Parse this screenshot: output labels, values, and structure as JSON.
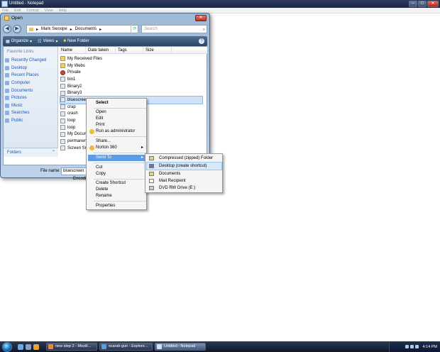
{
  "notepad": {
    "title": "Untitled - Notepad",
    "menu": [
      "File",
      "Edit",
      "Format",
      "View",
      "Help"
    ]
  },
  "dialog": {
    "title": "Open",
    "breadcrumb": [
      "Mark Swoope",
      "Documents"
    ],
    "search_placeholder": "Search",
    "toolbar": {
      "organize": "Organize",
      "views": "Views",
      "new_folder": "New Folder"
    },
    "favorite_links_header": "Favorite Links",
    "favorite_links": [
      "Recently Changed",
      "Desktop",
      "Recent Places",
      "Computer",
      "Documents",
      "Pictures",
      "Music",
      "Searches",
      "Public"
    ],
    "folders_label": "Folders",
    "columns": [
      "Name",
      "Date taken",
      "Tags",
      "Size"
    ],
    "files": [
      {
        "name": "My Received Files",
        "kind": "folder"
      },
      {
        "name": "My Webs",
        "kind": "folder"
      },
      {
        "name": "Private",
        "kind": "app"
      },
      {
        "name": "bin1",
        "kind": "file"
      },
      {
        "name": "Binary2",
        "kind": "file"
      },
      {
        "name": "Binary3",
        "kind": "file"
      },
      {
        "name": "bluescreen",
        "kind": "file"
      },
      {
        "name": "crap",
        "kind": "file"
      },
      {
        "name": "crash",
        "kind": "file"
      },
      {
        "name": "loop",
        "kind": "file"
      },
      {
        "name": "loop",
        "kind": "file"
      },
      {
        "name": "My Docum",
        "kind": "file"
      },
      {
        "name": "permanent",
        "kind": "file"
      },
      {
        "name": "Screen Sna",
        "kind": "file"
      }
    ],
    "selected_index": 6,
    "file_name_label": "File name:",
    "file_name_value": "bluescreen",
    "encoding_label": "Encoding"
  },
  "context_menu": {
    "items": [
      "Select",
      "Open",
      "Edit",
      "Print",
      "Run as administrator",
      "Share...",
      "Norton 360",
      "Send To",
      "Cut",
      "Copy",
      "Create Shortcut",
      "Delete",
      "Rename",
      "Properties"
    ]
  },
  "send_to_menu": {
    "items": [
      "Compressed (zipped) Folder",
      "Desktop (create shortcut)",
      "Documents",
      "Mail Recipient",
      "DVD RW Drive (E:)"
    ]
  },
  "taskbar": {
    "tasks": [
      "new step 2 - Mozill...",
      "scarab gun - Explore...",
      "Untitled - Notepad"
    ],
    "clock": "4:14 PM"
  },
  "colors": {
    "accent": "#5f9be0",
    "link": "#1d56b4",
    "taskbar": "#0e1626"
  }
}
